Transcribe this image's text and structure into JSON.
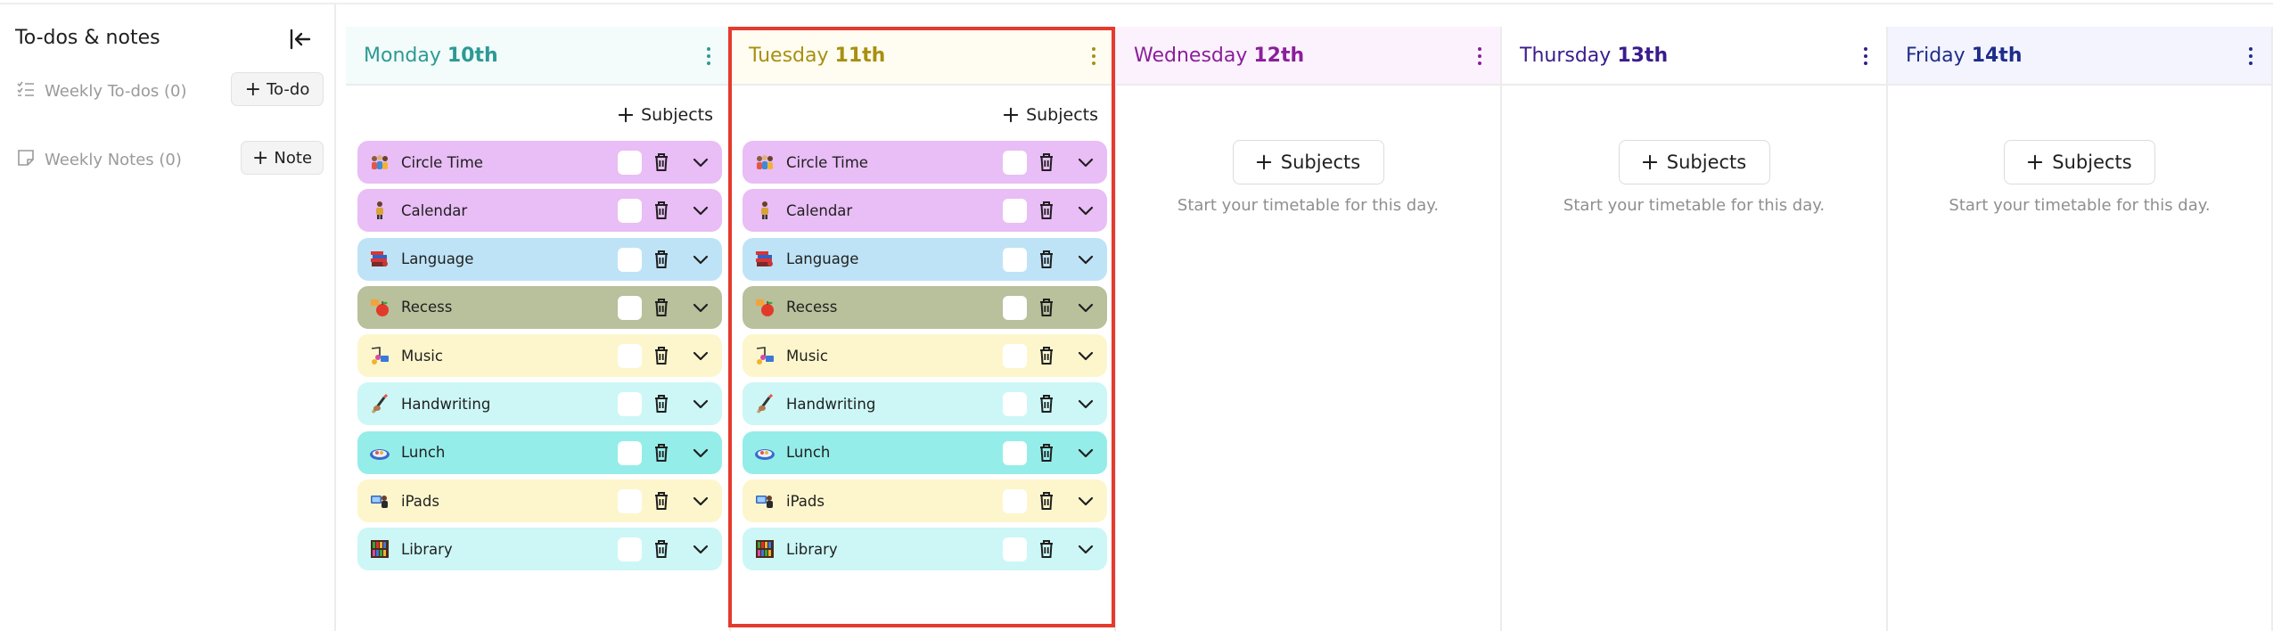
{
  "sidebar": {
    "title": "To-dos & notes",
    "collapse_icon": "collapse-left-icon",
    "todos_label": "Weekly To-dos (0)",
    "todos_button": "To-do",
    "notes_label": "Weekly Notes (0)",
    "notes_button": "Note"
  },
  "colors": {
    "highlight": "#e53a2d",
    "purple_subject": "#e9bdf5",
    "blue_subject": "#bfe3f6",
    "olive_subject": "#b8c09c",
    "yellow_subject": "#fdf6cc",
    "cyan_subject": "#ccf7f6",
    "teal_subject": "#95ede9"
  },
  "add_subjects_label": "Subjects",
  "empty_hint": "Start your timetable for this day.",
  "days": [
    {
      "day": "Monday",
      "date": "10th",
      "color": "#2c9a95",
      "header_bg": "#f3fcfb",
      "has_subjects": true,
      "subjects": [
        {
          "label": "Circle Time",
          "icon": "children-circle-icon",
          "bg": "#e9bdf5"
        },
        {
          "label": "Calendar",
          "icon": "calendar-person-icon",
          "bg": "#e9bdf5"
        },
        {
          "label": "Language",
          "icon": "books-icon",
          "bg": "#bfe3f6"
        },
        {
          "label": "Recess",
          "icon": "apple-snack-icon",
          "bg": "#b8c09c"
        },
        {
          "label": "Music",
          "icon": "music-instruments-icon",
          "bg": "#fdf6cc"
        },
        {
          "label": "Handwriting",
          "icon": "pencil-hand-icon",
          "bg": "#ccf7f6"
        },
        {
          "label": "Lunch",
          "icon": "lunch-tray-icon",
          "bg": "#95ede9"
        },
        {
          "label": "iPads",
          "icon": "ipad-icon",
          "bg": "#fdf6cc"
        },
        {
          "label": "Library",
          "icon": "bookshelf-icon",
          "bg": "#ccf7f6"
        }
      ]
    },
    {
      "day": "Tuesday",
      "date": "11th",
      "color": "#a8900f",
      "header_bg": "#fffdf2",
      "has_subjects": true,
      "subjects": [
        {
          "label": "Circle Time",
          "icon": "children-circle-icon",
          "bg": "#e9bdf5"
        },
        {
          "label": "Calendar",
          "icon": "calendar-person-icon",
          "bg": "#e9bdf5"
        },
        {
          "label": "Language",
          "icon": "books-icon",
          "bg": "#bfe3f6"
        },
        {
          "label": "Recess",
          "icon": "apple-snack-icon",
          "bg": "#b8c09c"
        },
        {
          "label": "Music",
          "icon": "music-instruments-icon",
          "bg": "#fdf6cc"
        },
        {
          "label": "Handwriting",
          "icon": "pencil-hand-icon",
          "bg": "#ccf7f6"
        },
        {
          "label": "Lunch",
          "icon": "lunch-tray-icon",
          "bg": "#95ede9"
        },
        {
          "label": "iPads",
          "icon": "ipad-icon",
          "bg": "#fdf6cc"
        },
        {
          "label": "Library",
          "icon": "bookshelf-icon",
          "bg": "#ccf7f6"
        }
      ]
    },
    {
      "day": "Wednesday",
      "date": "12th",
      "color": "#8a1f9a",
      "header_bg": "#fcf2fd",
      "has_subjects": false,
      "subjects": []
    },
    {
      "day": "Thursday",
      "date": "13th",
      "color": "#3a1c8e",
      "header_bg": "#ffffff",
      "has_subjects": false,
      "subjects": []
    },
    {
      "day": "Friday",
      "date": "14th",
      "color": "#1e2d8a",
      "header_bg": "#f3f4fd",
      "has_subjects": false,
      "subjects": []
    }
  ]
}
